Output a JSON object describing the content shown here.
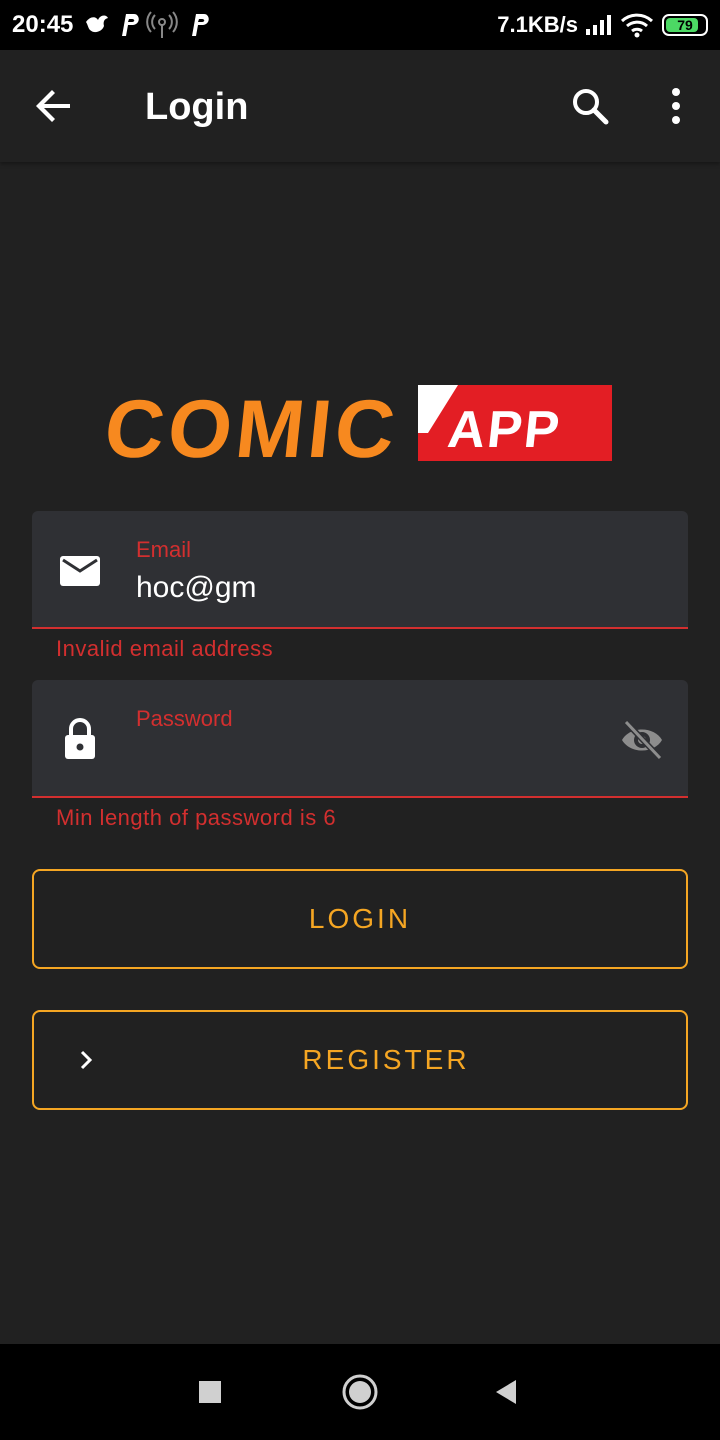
{
  "status_bar": {
    "time": "20:45",
    "net_speed": "7.1KB/s",
    "battery": "79",
    "icons": [
      "bird-icon",
      "p-icon",
      "hotspot-icon",
      "p-icon",
      "signal-icon",
      "wifi-icon",
      "battery-icon"
    ]
  },
  "app_bar": {
    "title": "Login",
    "icons": [
      "back-arrow-icon",
      "search-icon",
      "more-vert-icon"
    ]
  },
  "logo": {
    "text_left": "COMIC",
    "text_right": "APP",
    "colors": {
      "orange": "#f7891f",
      "red": "#e31e24"
    }
  },
  "email_field": {
    "label": "Email",
    "value": "hoc@gm",
    "error": "Invalid email address",
    "icon": "mail-icon"
  },
  "password_field": {
    "label": "Password",
    "value": "",
    "error": "Min length of password is 6",
    "icon": "lock-icon",
    "toggle_icon": "visibility-off-icon"
  },
  "buttons": {
    "login": "LOGIN",
    "register": "REGISTER"
  },
  "colors": {
    "background": "#212121",
    "field": "#2f3034",
    "error": "#d32f2f",
    "accent": "#f5a623"
  },
  "nav_bar": {
    "icons": [
      "recents-square-icon",
      "home-circle-icon",
      "back-triangle-icon"
    ]
  }
}
